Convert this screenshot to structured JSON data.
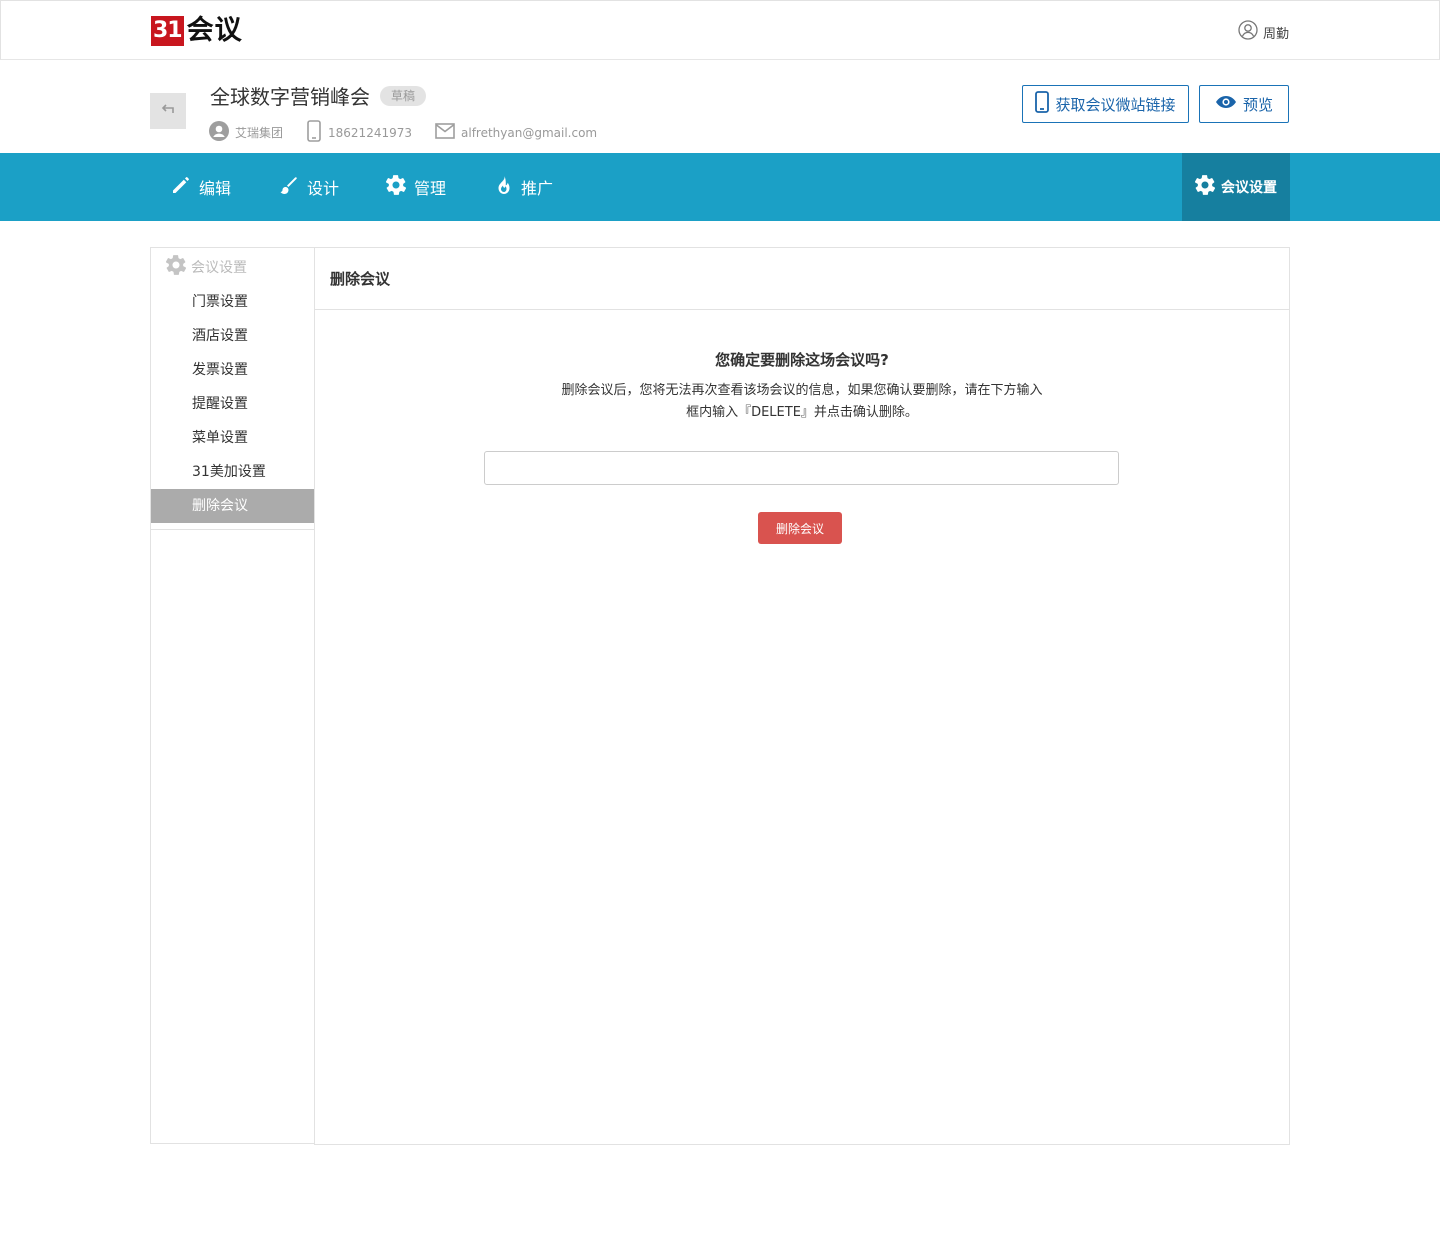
{
  "header": {
    "logo_number": "31",
    "logo_text": "会议",
    "user_name": "周勤"
  },
  "event": {
    "title": "全球数字营销峰会",
    "status_badge": "草稿",
    "organizer": "艾瑞集团",
    "phone": "18621241973",
    "email": "alfrethyan@gmail.com",
    "microsite_button": "获取会议微站链接",
    "preview_button": "预览"
  },
  "nav": {
    "items": [
      {
        "label": "编辑",
        "icon": "pencil-icon"
      },
      {
        "label": "设计",
        "icon": "brush-icon"
      },
      {
        "label": "管理",
        "icon": "gear-icon"
      },
      {
        "label": "推广",
        "icon": "flame-icon"
      }
    ],
    "settings_label": "会议设置"
  },
  "sidebar": {
    "heading": "会议设置",
    "items": [
      {
        "label": "门票设置"
      },
      {
        "label": "酒店设置"
      },
      {
        "label": "发票设置"
      },
      {
        "label": "提醒设置"
      },
      {
        "label": "菜单设置"
      },
      {
        "label": "31美加设置"
      },
      {
        "label": "删除会议",
        "active": true
      }
    ]
  },
  "main": {
    "heading": "删除会议",
    "confirm_title": "您确定要删除这场会议吗?",
    "confirm_desc_line1": "删除会议后，您将无法再次查看该场会议的信息，如果您确认要删除，请在下方输入",
    "confirm_desc_line2": "框内输入『DELETE』并点击确认删除。",
    "input_value": "",
    "input_placeholder": "",
    "delete_button": "删除会议"
  },
  "colors": {
    "nav_bg": "#1ba0c6",
    "nav_active_bg": "#167f9f",
    "brand_red": "#c8161e",
    "danger": "#d9534f",
    "link_blue": "#1a64aa"
  }
}
